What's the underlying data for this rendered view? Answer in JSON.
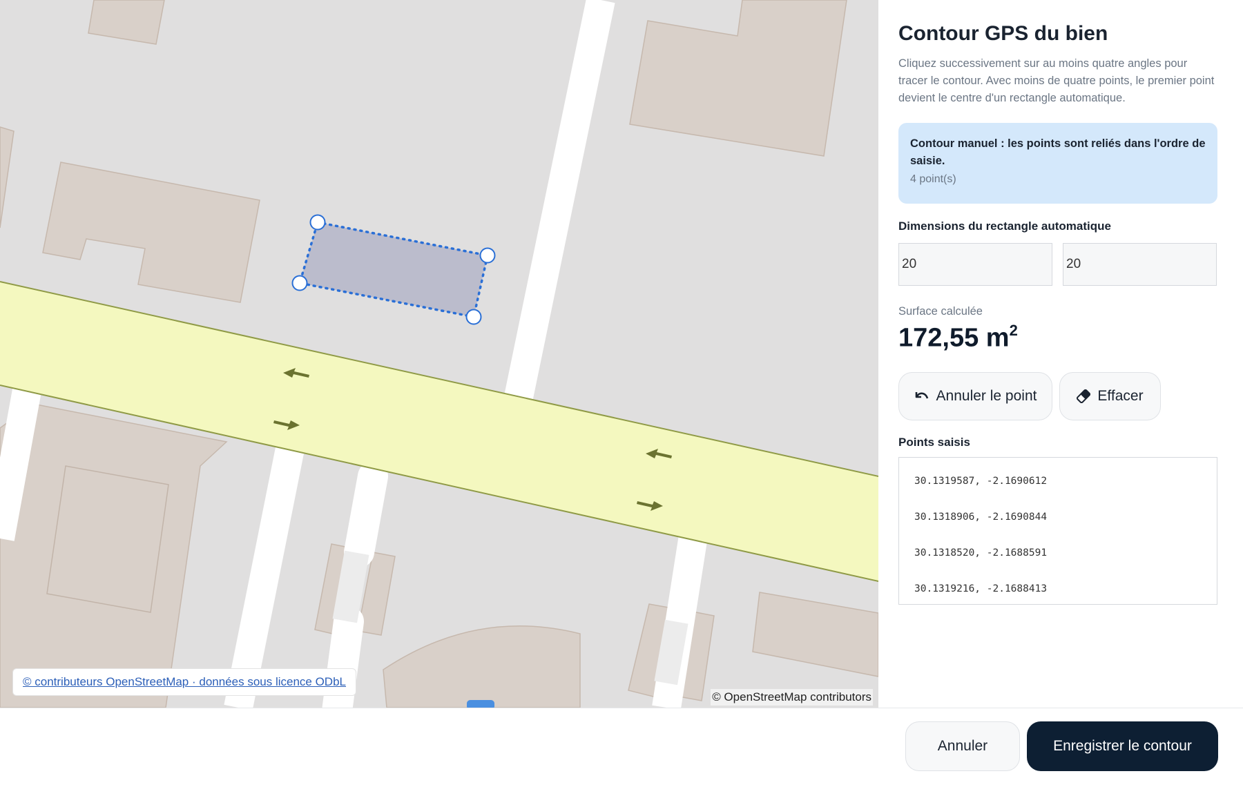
{
  "map": {
    "osm_link": "© contributeurs OpenStreetMap · données sous licence ODbL",
    "credit": "© OpenStreetMap contributors",
    "colors": {
      "background": "#e0dfdf",
      "building": "#d9d0c9",
      "road": "#f4f8bf",
      "polygon": "#bbbccc",
      "polygon_stroke": "#2a6fd6"
    }
  },
  "panel": {
    "title": "Contour GPS du bien",
    "intro": "Cliquez successivement sur au moins quatre angles pour tracer le contour. Avec moins de quatre points, le premier point devient le centre d'un rectangle automatique.",
    "info": {
      "title": "Contour manuel : les points sont reliés dans l'ordre de saisie.",
      "count": "4 point(s)"
    },
    "dimensions_label": "Dimensions du rectangle automatique",
    "width_value": "20",
    "length_value": "20",
    "surface_label": "Surface calculée",
    "surface_value": "172,55 m",
    "surface_unit_exponent": "2",
    "undo_label": "Annuler le point",
    "clear_label": "Effacer",
    "points_label": "Points saisis",
    "points": [
      "30.1319587, -2.1690612",
      "30.1318906, -2.1690844",
      "30.1318520, -2.1688591",
      "30.1319216, -2.1688413"
    ]
  },
  "footer": {
    "cancel_label": "Annuler",
    "save_label": "Enregistrer le contour"
  }
}
